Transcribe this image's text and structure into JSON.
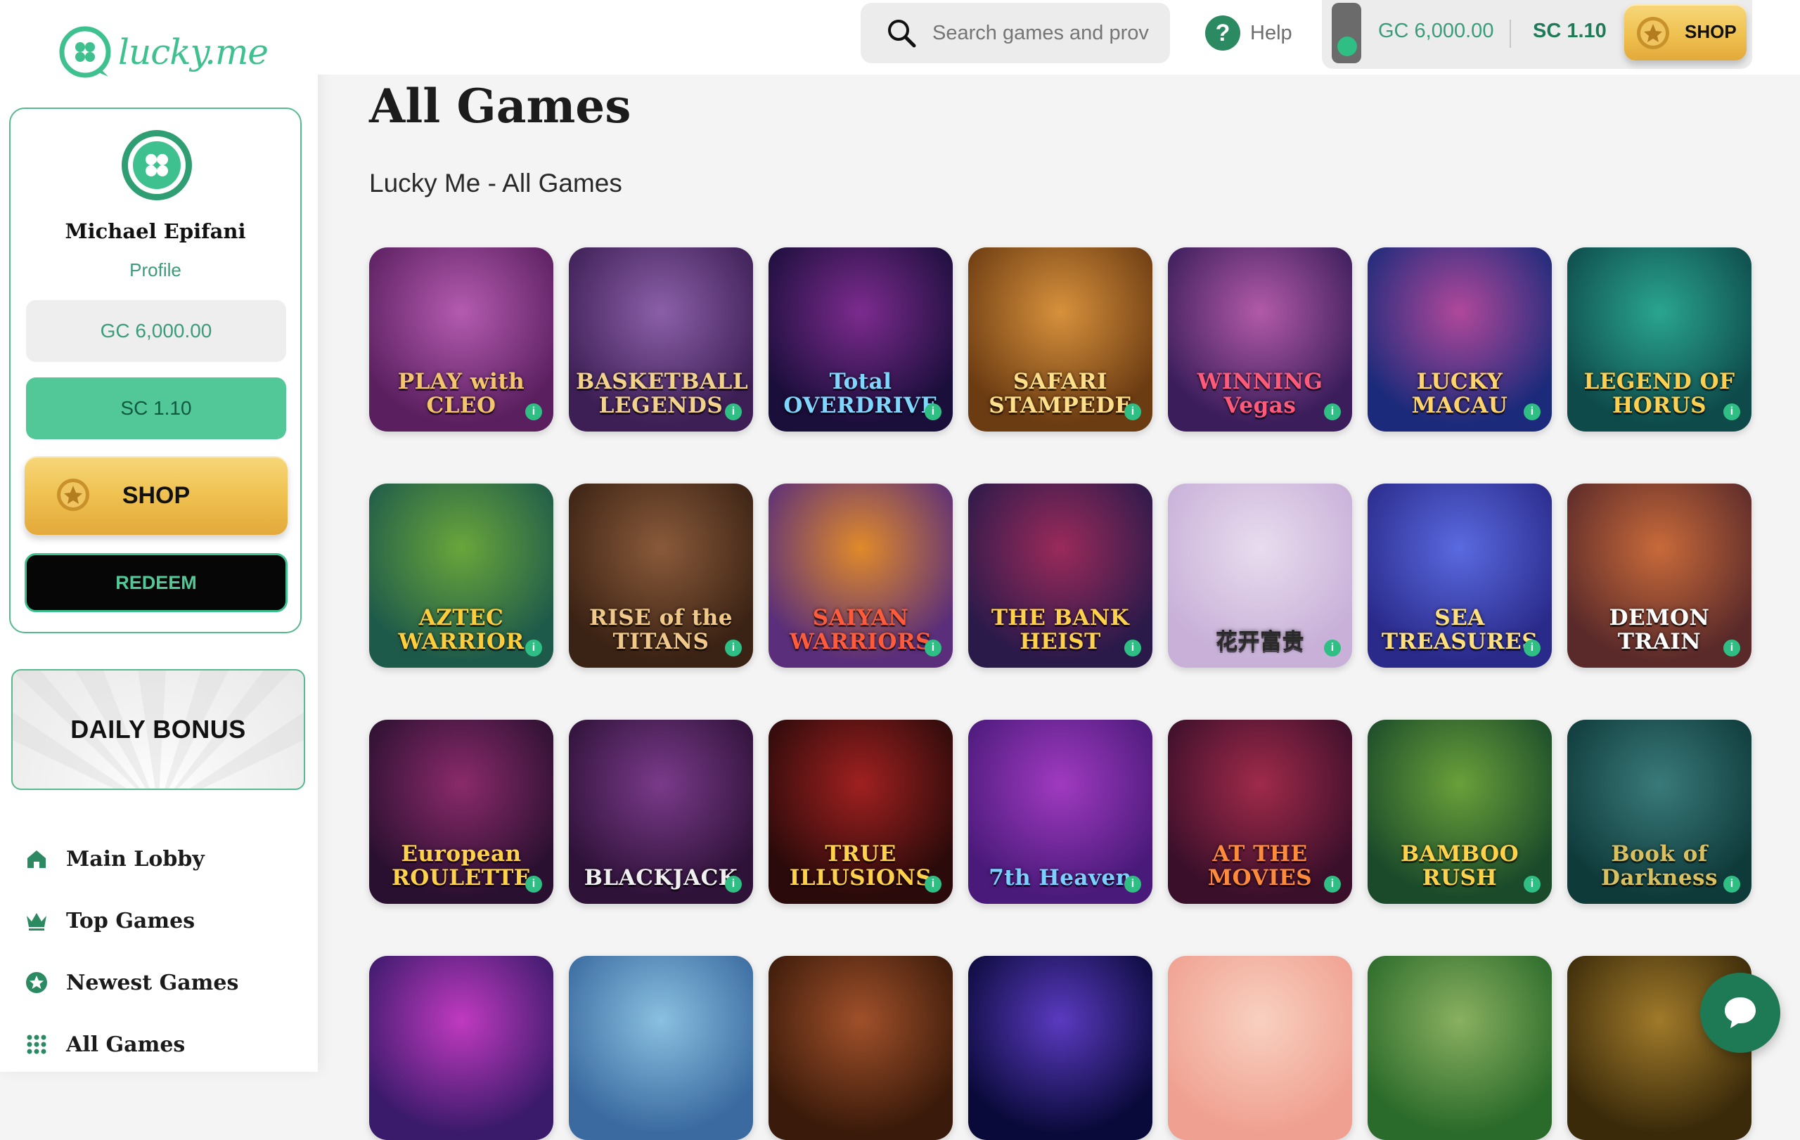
{
  "brand": {
    "name": "lucky.me",
    "accent": "#3ec18f",
    "gold": "#efc150"
  },
  "profile": {
    "name": "Michael Epifani",
    "link": "Profile",
    "gc_balance": "GC 6,000.00",
    "sc_balance": "SC 1.10",
    "shop_label": "SHOP",
    "redeem_label": "REDEEM"
  },
  "daily_bonus": {
    "label": "DAILY BONUS"
  },
  "nav": [
    {
      "label": "Main Lobby",
      "icon": "home-icon"
    },
    {
      "label": "Top Games",
      "icon": "crown-icon"
    },
    {
      "label": "Newest Games",
      "icon": "star-icon"
    },
    {
      "label": "All Games",
      "icon": "grid-icon"
    }
  ],
  "topbar": {
    "search_placeholder": "Search games and prov",
    "help_label": "Help",
    "gc": "GC 6,000.00",
    "sc": "SC 1.10",
    "shop_label": "SHOP"
  },
  "page": {
    "title": "All Games",
    "section": "Lucky Me - All Games"
  },
  "games": [
    {
      "name": "PLAY with CLEO",
      "bg": [
        "#5a1f5f",
        "#b45bb0"
      ],
      "color": "#f4c56a"
    },
    {
      "name": "BASKETBALL LEGENDS",
      "bg": [
        "#3d1f55",
        "#8b5fa8"
      ],
      "color": "#f3d38b"
    },
    {
      "name": "Total OVERDRIVE",
      "bg": [
        "#1a0e3a",
        "#7c2b8e"
      ],
      "color": "#7fd6ff"
    },
    {
      "name": "SAFARI STAMPEDE",
      "bg": [
        "#6b3b12",
        "#d7913c"
      ],
      "color": "#ffe08a"
    },
    {
      "name": "WINNING Vegas",
      "bg": [
        "#3a1d5a",
        "#b25aa8"
      ],
      "color": "#ff5a7a"
    },
    {
      "name": "LUCKY MACAU",
      "bg": [
        "#1b2a7a",
        "#b0489a"
      ],
      "color": "#ffd46a"
    },
    {
      "name": "LEGEND OF HORUS",
      "bg": [
        "#0e4a4a",
        "#2aa58f"
      ],
      "color": "#ffd050"
    },
    {
      "name": "AZTEC WARRIOR",
      "bg": [
        "#1e5a4a",
        "#6aa63a"
      ],
      "color": "#ffcc3a"
    },
    {
      "name": "RISE of the TITANS",
      "bg": [
        "#3a2214",
        "#8a5a3a"
      ],
      "color": "#f0c98a"
    },
    {
      "name": "SAIYAN WARRIORS",
      "bg": [
        "#5a2e7a",
        "#e08a2a"
      ],
      "color": "#ff5a3a"
    },
    {
      "name": "THE BANK HEIST",
      "bg": [
        "#2a1a4a",
        "#9a2a5a"
      ],
      "color": "#ffd24a"
    },
    {
      "name": "花开富贵",
      "bg": [
        "#c8b0d8",
        "#e8dcee"
      ],
      "color": "#2a2a2a"
    },
    {
      "name": "SEA TREASURES",
      "bg": [
        "#2a2a8a",
        "#5a6ae0"
      ],
      "color": "#ffe07a"
    },
    {
      "name": "DEMON TRAIN",
      "bg": [
        "#5a2a2a",
        "#c86a3a"
      ],
      "color": "#ffffff"
    },
    {
      "name": "European ROULETTE",
      "bg": [
        "#2a1030",
        "#8a2a6a"
      ],
      "color": "#ffd24a"
    },
    {
      "name": "BLACKJACK",
      "bg": [
        "#2e1238",
        "#7a3a8a"
      ],
      "color": "#f0f0f0"
    },
    {
      "name": "TRUE ILLUSIONS",
      "bg": [
        "#2a0a0a",
        "#a02020"
      ],
      "color": "#ffd24a"
    },
    {
      "name": "7th Heaven",
      "bg": [
        "#4a1a7a",
        "#a03ac0"
      ],
      "color": "#7ad0ff"
    },
    {
      "name": "AT THE MOVIES",
      "bg": [
        "#3a0f2a",
        "#a02a4a"
      ],
      "color": "#ff8a3a"
    },
    {
      "name": "BAMBOO RUSH",
      "bg": [
        "#1a4a2a",
        "#6aa03a"
      ],
      "color": "#ffd24a"
    },
    {
      "name": "Book of Darkness",
      "bg": [
        "#0f3a3a",
        "#3a7a7a"
      ],
      "color": "#d8c060"
    },
    {
      "name": "",
      "bg": [
        "#3a1a6a",
        "#c03ac0"
      ],
      "color": "#ffffff"
    },
    {
      "name": "",
      "bg": [
        "#3a6aa0",
        "#8ac0e0"
      ],
      "color": "#ffffff"
    },
    {
      "name": "",
      "bg": [
        "#3a1a0a",
        "#a0502a"
      ],
      "color": "#ffffff"
    },
    {
      "name": "",
      "bg": [
        "#0a0a3a",
        "#5a3ac0"
      ],
      "color": "#ffffff"
    },
    {
      "name": "",
      "bg": [
        "#f0a090",
        "#f8d0c0"
      ],
      "color": "#ffffff"
    },
    {
      "name": "",
      "bg": [
        "#2a6a2a",
        "#8ab060"
      ],
      "color": "#ffffff"
    },
    {
      "name": "",
      "bg": [
        "#3a2a0a",
        "#a07a2a"
      ],
      "color": "#ffffff"
    }
  ]
}
